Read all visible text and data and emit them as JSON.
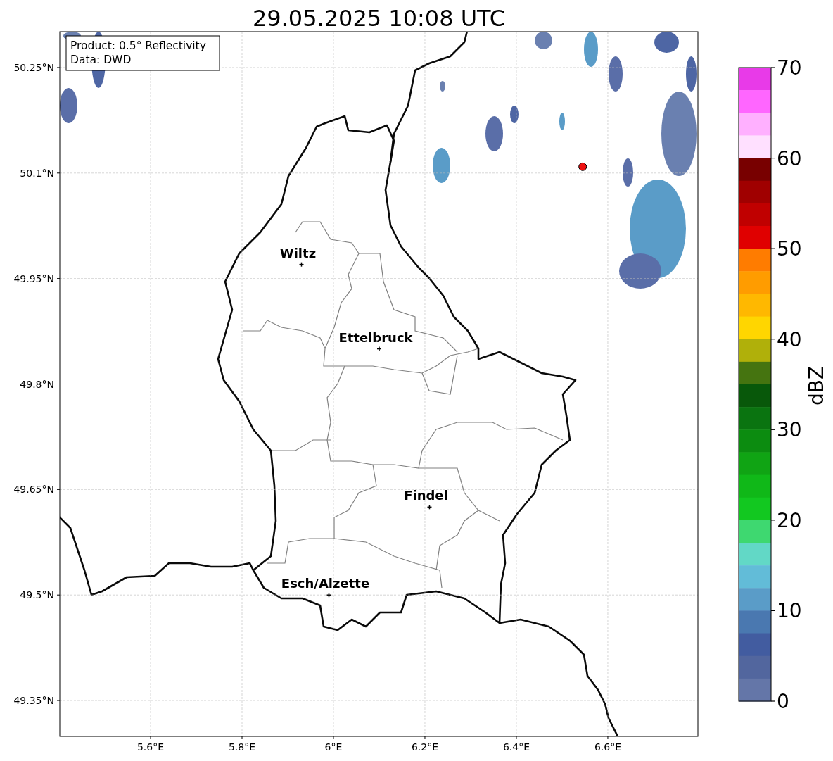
{
  "title": "29.05.2025 10:08 UTC",
  "info_box": [
    "Product: 0.5° Reflectivity",
    "Data: DWD"
  ],
  "map": {
    "chart_data": {
      "type": "scatter",
      "xlim": [
        5.4015,
        6.797
      ],
      "ylim": [
        49.299,
        50.301
      ],
      "xticks": [
        {
          "value": 5.6,
          "label": "5.6°E"
        },
        {
          "value": 5.8,
          "label": "5.8°E"
        },
        {
          "value": 6.0,
          "label": "6°E"
        },
        {
          "value": 6.2,
          "label": "6.2°E"
        },
        {
          "value": 6.4,
          "label": "6.4°E"
        },
        {
          "value": 6.6,
          "label": "6.6°E"
        }
      ],
      "yticks": [
        {
          "value": 49.35,
          "label": "49.35°N"
        },
        {
          "value": 49.5,
          "label": "49.5°N"
        },
        {
          "value": 49.65,
          "label": "49.65°N"
        },
        {
          "value": 49.8,
          "label": "49.8°N"
        },
        {
          "value": 49.95,
          "label": "49.95°N"
        },
        {
          "value": 50.1,
          "label": "50.1°N"
        },
        {
          "value": 50.25,
          "label": "50.25°N"
        }
      ],
      "grid": true,
      "x": [
        5.93,
        6.1,
        6.21,
        5.99,
        6.545
      ],
      "series": [
        {
          "color": "#000000",
          "values": [
            49.97,
            49.85,
            49.625,
            49.5,
            null
          ]
        },
        {
          "color": "#ee1111",
          "values": [
            null,
            null,
            null,
            null,
            50.109
          ]
        }
      ],
      "annotations": [
        "Wiltz",
        "Ettelbruck",
        "Findel",
        "Esch/Alzette"
      ]
    }
  },
  "colorbar": {
    "label": "dBZ",
    "ticks": [
      "70",
      "60",
      "50",
      "40",
      "30",
      "20",
      "10",
      "0"
    ],
    "bins": [
      {
        "color": "#e83ae8"
      },
      {
        "color": "#ff66ff"
      },
      {
        "color": "#ffb0ff"
      },
      {
        "color": "#ffe0ff"
      },
      {
        "color": "#780000"
      },
      {
        "color": "#a00000"
      },
      {
        "color": "#c00000"
      },
      {
        "color": "#e00000"
      },
      {
        "color": "#ff7c00"
      },
      {
        "color": "#ff9c00"
      },
      {
        "color": "#ffb800"
      },
      {
        "color": "#ffd600"
      },
      {
        "color": "#b0b00a"
      },
      {
        "color": "#457410"
      },
      {
        "color": "#08580a"
      },
      {
        "color": "#0a7410"
      },
      {
        "color": "#0c8c10"
      },
      {
        "color": "#10a414"
      },
      {
        "color": "#10b818"
      },
      {
        "color": "#12c820"
      },
      {
        "color": "#3ed870"
      },
      {
        "color": "#62d8c6"
      },
      {
        "color": "#62bcd8"
      },
      {
        "color": "#5a9cc8"
      },
      {
        "color": "#4a78b0"
      },
      {
        "color": "#425ca0"
      },
      {
        "color": "#52669e"
      },
      {
        "color": "#6476a8"
      }
    ]
  }
}
